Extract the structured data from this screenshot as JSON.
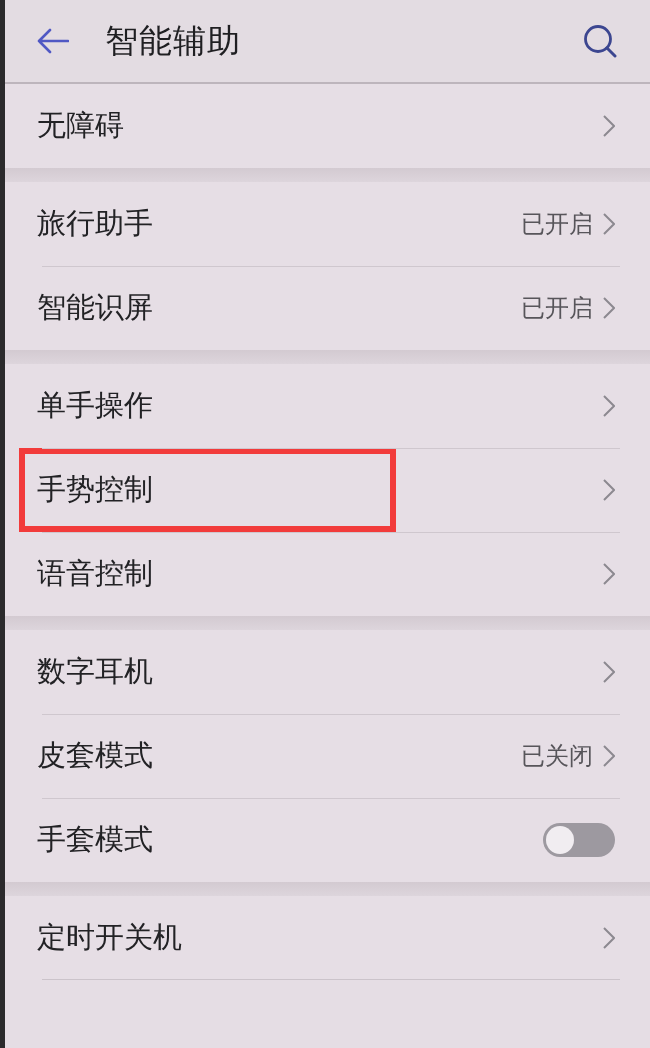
{
  "header": {
    "title": "智能辅助"
  },
  "groups": [
    {
      "items": [
        {
          "kind": "link",
          "label": "无障碍",
          "highlighted": false
        }
      ]
    },
    {
      "items": [
        {
          "kind": "link",
          "label": "旅行助手",
          "value": "已开启",
          "highlighted": false
        },
        {
          "kind": "link",
          "label": "智能识屏",
          "value": "已开启",
          "highlighted": false
        }
      ]
    },
    {
      "items": [
        {
          "kind": "link",
          "label": "单手操作",
          "highlighted": false
        },
        {
          "kind": "link",
          "label": "手势控制",
          "highlighted": true
        },
        {
          "kind": "link",
          "label": "语音控制",
          "highlighted": false
        }
      ]
    },
    {
      "items": [
        {
          "kind": "link",
          "label": "数字耳机",
          "highlighted": false
        },
        {
          "kind": "link",
          "label": "皮套模式",
          "value": "已关闭",
          "highlighted": false
        },
        {
          "kind": "switch",
          "label": "手套模式",
          "on": false,
          "highlighted": false
        }
      ]
    },
    {
      "items": [
        {
          "kind": "link",
          "label": "定时开关机",
          "highlighted": false
        }
      ]
    }
  ]
}
